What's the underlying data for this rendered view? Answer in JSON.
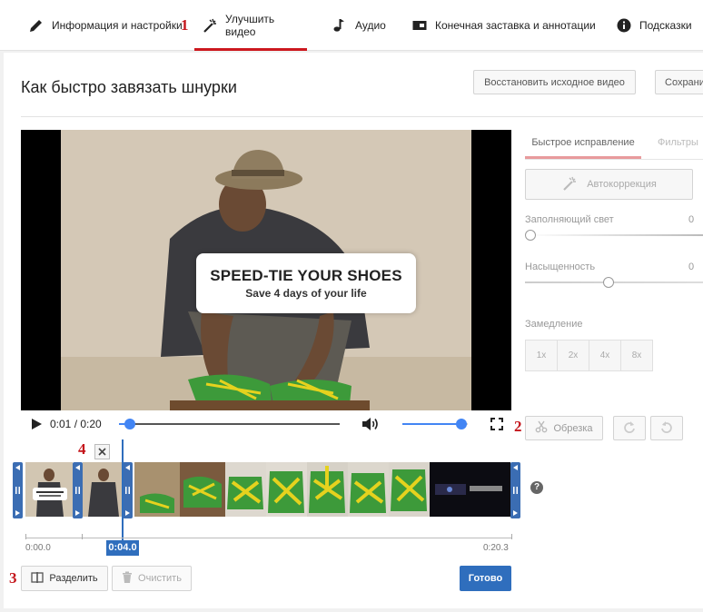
{
  "tabs": [
    {
      "label": "Информация и настройки",
      "icon": "pencil-icon"
    },
    {
      "label": "Улучшить видео",
      "icon": "magic-wand-icon"
    },
    {
      "label": "Аудио",
      "icon": "music-note-icon"
    },
    {
      "label": "Конечная заставка и аннотации",
      "icon": "end-screen-icon"
    },
    {
      "label": "Подсказки",
      "icon": "info-icon"
    }
  ],
  "annotations": [
    "1",
    "2",
    "3",
    "4"
  ],
  "title": "Как быстро завязать шнурки",
  "header_buttons": {
    "restore": "Восстановить исходное видео",
    "save": "Сохрани"
  },
  "video": {
    "overlay_line1": "SPEED-TIE YOUR SHOES",
    "overlay_line2": "Save 4 days of your life",
    "time": "0:01 / 0:20",
    "progress": 0.05,
    "volume": 0.9
  },
  "right_panel": {
    "tabs": [
      "Быстрое исправление",
      "Фильтры"
    ],
    "autocorrect": "Автокоррекция",
    "fill_light_label": "Заполняющий свет",
    "fill_light_value": "0",
    "fill_light_level": 0,
    "saturation_label": "Насыщенность",
    "saturation_value": "0",
    "saturation_level": 0.47,
    "slowmo_label": "Замедление",
    "speeds": [
      "1x",
      "2x",
      "4x",
      "8x"
    ],
    "trim": "Обрезка"
  },
  "timeline": {
    "start": "0:00.0",
    "current": "0:04.0",
    "end": "0:20.3",
    "help": "?"
  },
  "bottom": {
    "split": "Разделить",
    "clear": "Очистить",
    "done": "Готово"
  },
  "colors": {
    "accent_red": "#cc181e",
    "accent_blue": "#2f6ebd",
    "annotation_red": "#c4161c"
  }
}
